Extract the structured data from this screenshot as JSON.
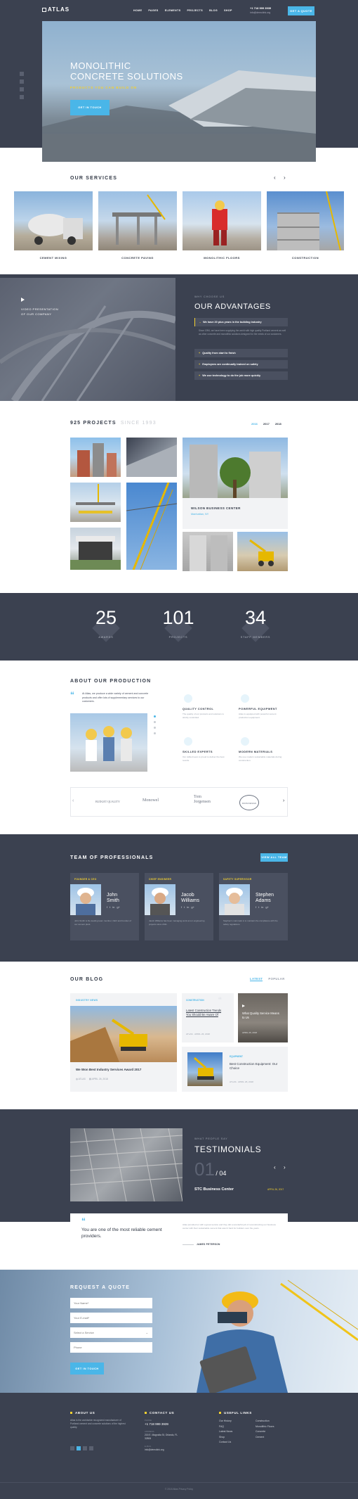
{
  "header": {
    "logo": "ATLAS",
    "nav": [
      "HOME",
      "PAGES",
      "ELEMENTS",
      "PROJECTS",
      "BLOG",
      "SHOP"
    ],
    "phone": "+1 718 999 3939",
    "email": "info@demolink.org",
    "cta": "GET A QUOTE"
  },
  "hero": {
    "title_line1": "MONOLITHIC",
    "title_line2": "CONCRETE SOLUTIONS",
    "subtitle": "PRODUCTS YOU CAN BUILD ON",
    "button": "GET IN TOUCH"
  },
  "services": {
    "heading": "OUR SERVICES",
    "items": [
      "CEMENT MIXING",
      "CONCRETE PAVING",
      "MONOLITHIC FLOORS",
      "CONSTRUCTION"
    ]
  },
  "advantages": {
    "video_label_1": "VIDEO PRESENTATION",
    "video_label_2": "OF OUR COMPANY",
    "kicker": "WHY CHOOSE US",
    "heading": "OUR ADVANTAGES",
    "items": [
      "We have 20 plus years in the building industry",
      "Quality from start to finish",
      "Employees are continually trained on safety",
      "We use technology to do the job more quickly"
    ],
    "text": "Since 1994, we have been supplying the world with high quality Portland cement as well as other concrete and monolithic solutions designed for the needs of our customers."
  },
  "projects": {
    "count": "925 PROJECTS",
    "since": "SINCE 1993",
    "years": [
      "2016",
      "2017",
      "2018"
    ],
    "featured_title": "WILSON BUSINESS CENTER",
    "featured_sub": "Manhattan, NY"
  },
  "stats": [
    {
      "value": "25",
      "label": "AWARDS"
    },
    {
      "value": "101",
      "label": "PROJECTS"
    },
    {
      "value": "34",
      "label": "STAFF MEMBERS"
    }
  ],
  "production": {
    "heading": "ABOUT OUR PRODUCTION",
    "quote": "At Atlas, we produce a wide variety of cement and concrete products and offer lots of supplementary services to our customers.",
    "features": [
      {
        "title": "QUALITY CONTROL",
        "text": "The quality of our products and solutions is strictly controlled."
      },
      {
        "title": "POWERFUL EQUIPMENT",
        "text": "Atlas is equipped with powerful cement production equipment."
      },
      {
        "title": "SKILLED EXPERTS",
        "text": "Our skilled team is proud to deliver the best results."
      },
      {
        "title": "MODERN MATERIALS",
        "text": "We use modern sustainable materials during construction."
      }
    ],
    "logos": [
      "BUDGET QUALITY",
      "Monowel",
      "Tom Jorgensen",
      "ROOM DESIGN"
    ]
  },
  "team": {
    "heading": "TEAM OF PROFESSIONALS",
    "button": "VIEW ALL TEAM",
    "members": [
      {
        "role": "FOUNDER & CEO",
        "first": "John",
        "last": "Smith",
        "bio": "John Smith is the leading team member, CEO and founder of our cement plant."
      },
      {
        "role": "CHIEF ENGINEER",
        "first": "Jacob",
        "last": "Williams",
        "bio": "Jacob Williams has been managing work at our engineering projects since 2011."
      },
      {
        "role": "SAFETY SUPERVISOR",
        "first": "Stephen",
        "last": "Adams",
        "bio": "Stephen's main task is to maintain the compliance with the safety regulations."
      }
    ]
  },
  "blog": {
    "heading": "OUR BLOG",
    "tabs": [
      "LATEST",
      "POPULAR"
    ],
    "posts": [
      {
        "tag": "INDUSTRY NEWS",
        "title": "We Won Best Industry Services Award 2017",
        "meta": "ATLAS",
        "date": "APRIL 26, 2018"
      },
      {
        "tag": "CONSTRUCTION",
        "title": "Latest Construction Trends You Should Be Aware Of",
        "meta": "ATLAS",
        "date": "APRIL 26, 2018"
      },
      {
        "tag": "",
        "title": "What Quality Service Means to Us",
        "meta": "",
        "date": "APRIL 26, 2018"
      },
      {
        "tag": "EQUIPMENT",
        "title": "Best Construction Equipment: Our Choice",
        "meta": "ATLAS",
        "date": "APRIL 26, 2018"
      }
    ]
  },
  "testimonials": {
    "kicker": "WHAT PEOPLE SAY",
    "heading": "TESTIMONIALS",
    "current": "01",
    "total": "/ 04",
    "company": "STC Business Center",
    "date": "APRIL 26, 2017",
    "quote": "You are one of the most reliable cement providers.",
    "text": "Atlas provided us with a great service and they did a wonderful job of reconstructing our business center with their sustainable cement that wasn't hard for builders over the years.",
    "author": "JAMES PETERSON"
  },
  "quote_form": {
    "heading": "REQUEST A QUOTE",
    "name_ph": "Your Name*",
    "email_ph": "Your E-mail*",
    "service_ph": "Select a Service",
    "phone_ph": "Phone",
    "button": "GET IN TOUCH"
  },
  "footer": {
    "about_title": "ABOUT US",
    "about_text": "Atlas is the worldwide recognized manufacturer of Portland cement and concrete solutions of the highest quality.",
    "contact_title": "CONTACT US",
    "phone_label": "PHONE",
    "phone": "+1 718 999 3939",
    "address_label": "ADDRESS",
    "address": "215 E. Magnolia St, Orlando, FL 32806",
    "email_label": "E-MAIL",
    "email": "info@demolink.org",
    "links_title": "USEFUL LINKS",
    "links_col1": [
      "Our History",
      "FAQ",
      "Latest News",
      "Shop",
      "Contact Us"
    ],
    "links_col2": [
      "Construction",
      "Monolithic Floors",
      "Concrete",
      "Cement"
    ],
    "copyright": "© 2018 Atlas Privacy Policy"
  },
  "colors": {
    "accent": "#f4d130",
    "blue": "#4ab6e8",
    "dark": "#3b4150"
  }
}
